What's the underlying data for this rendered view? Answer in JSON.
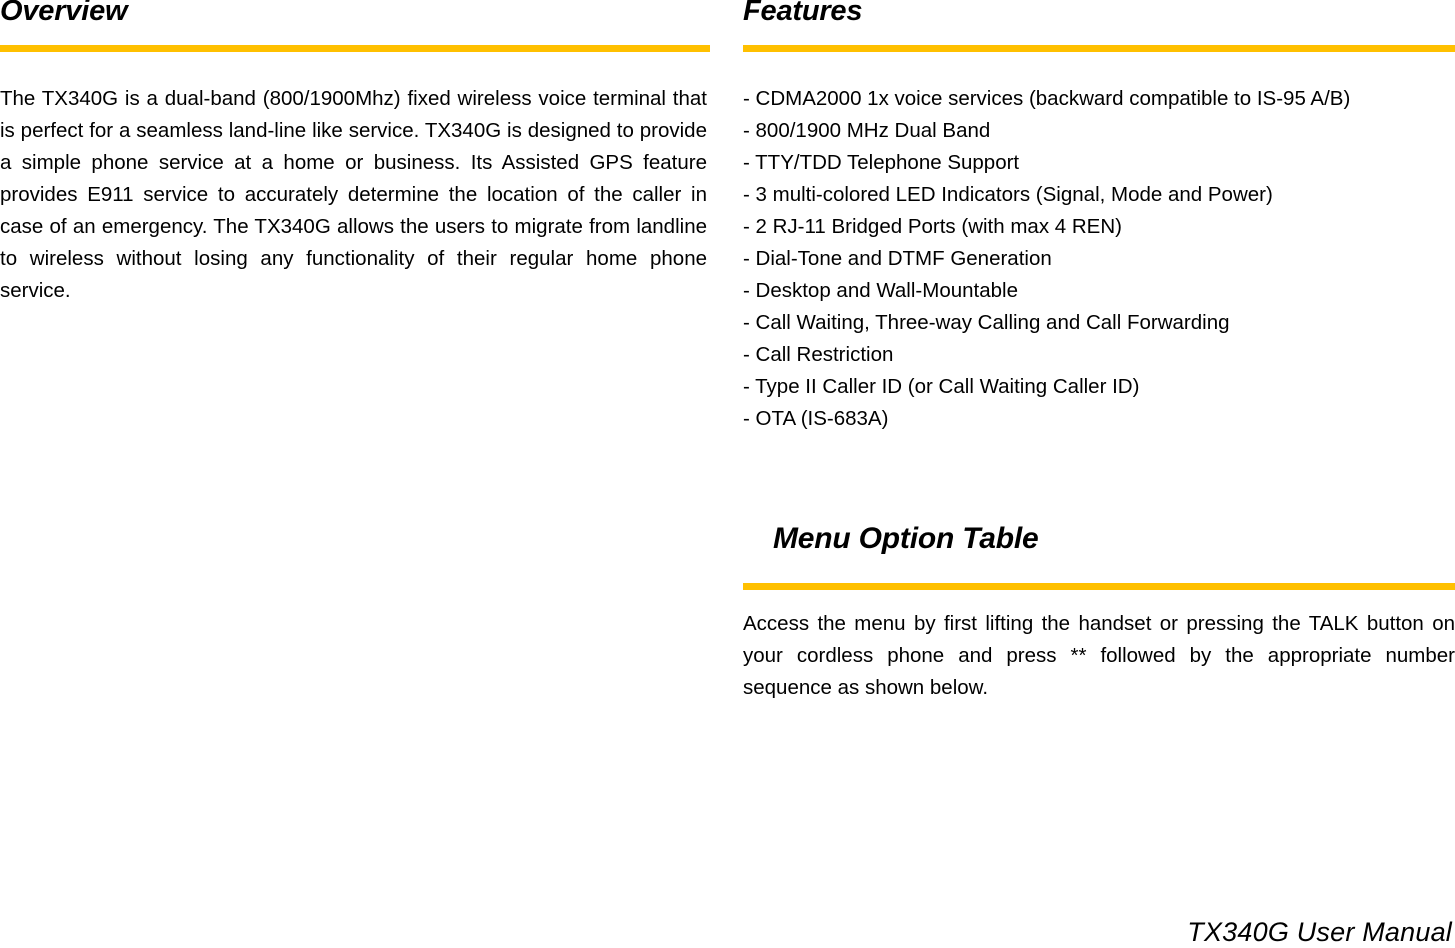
{
  "theme": {
    "accent_gold": "#FFC000",
    "text_color": "#000000",
    "page_background": "#FFFFFF"
  },
  "left_column": {
    "heading": "Overview",
    "paragraph": "The TX340G is a dual-band (800/1900Mhz) fixed wireless voice terminal that is perfect for a seamless land-line like service. TX340G is designed to provide a simple phone service at a home or business. Its Assisted GPS feature provides E911 service to accurately determine the location of the caller in case of an emergency. The TX340G allows the users to migrate from landline to wireless without losing any functionality of their regular home phone service."
  },
  "right_column": {
    "features": {
      "heading": "Features",
      "items": [
        "- CDMA2000 1x voice services (backward compatible to IS-95 A/B)",
        "- 800/1900 MHz Dual Band",
        "- TTY/TDD Telephone Support",
        "- 3 multi-colored LED Indicators (Signal, Mode and Power)",
        "- 2 RJ-11 Bridged Ports (with max 4 REN)",
        "- Dial-Tone and DTMF Generation",
        "- Desktop and Wall-Mountable",
        "- Call Waiting, Three-way Calling and Call Forwarding",
        "- Call Restriction",
        "- Type II Caller ID (or Call Waiting Caller ID)",
        "- OTA (IS-683A)"
      ]
    },
    "menu_option_table": {
      "heading": "Menu Option Table",
      "paragraph": "Access the menu by first lifting the handset or pressing the TALK button on your cordless phone and press ** followed by the appropriate number sequence as shown below."
    }
  },
  "footer": {
    "text": "TX340G User Manual"
  }
}
